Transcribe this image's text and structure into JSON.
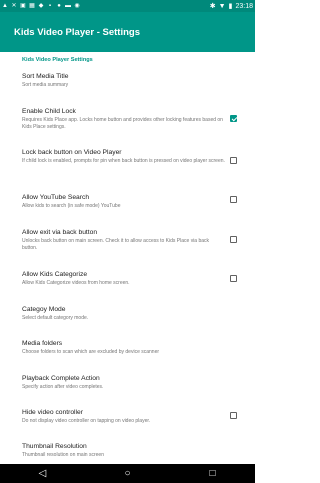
{
  "status_bar": {
    "left_icons": [
      "a-icon",
      "tools-icon",
      "photo-icon",
      "calendar-icon",
      "diamond-icon",
      "image-icon",
      "location-icon",
      "message-icon",
      "camera-icon"
    ],
    "time": "23:18"
  },
  "app_bar": {
    "title": "Kids Video Player - Settings"
  },
  "section": {
    "header": "Kids Video Player Settings"
  },
  "items": [
    {
      "title": "Sort Media Title",
      "summary": "Sort media summary",
      "has_checkbox": false
    },
    {
      "title": "Enable Child Lock",
      "summary": "Requires Kids Place app. Locks home button and provides other locking features based on Kids Place settings.",
      "has_checkbox": true,
      "checked": true
    },
    {
      "title": "Lock back button on Video Player",
      "summary": "If child lock is enabled, prompts for pin when back button is pressed on video player screen.",
      "has_checkbox": true,
      "checked": false
    },
    {
      "title": "Allow YouTube Search",
      "summary": "Allow kids to search (in safe mode) YouTube",
      "has_checkbox": true,
      "checked": false
    },
    {
      "title": "Allow exit via back button",
      "summary": "Unlocks back button on main screen. Check it to allow access to Kids Place via back button.",
      "has_checkbox": true,
      "checked": false
    },
    {
      "title": "Allow Kids Categorize",
      "summary": "Allow Kids Categorize videos from home screen.",
      "has_checkbox": true,
      "checked": false
    },
    {
      "title": "Categoy Mode",
      "summary": "Select default category mode.",
      "has_checkbox": false
    },
    {
      "title": "Media folders",
      "summary": "Choose folders to scan which are excluded by device scanner",
      "has_checkbox": false
    },
    {
      "title": "Playback Complete Action",
      "summary": "Specify action after video completes.",
      "has_checkbox": false
    },
    {
      "title": "Hide video controller",
      "summary": "Do not display video controller on tapping on video player.",
      "has_checkbox": true,
      "checked": false
    },
    {
      "title": "Thumbnail Resolution",
      "summary": "Thumbnail resolution on main screen",
      "has_checkbox": false
    }
  ],
  "nav_bar": {
    "back": "◁",
    "home": "○",
    "recents": "□"
  },
  "colors": {
    "primary": "#009688",
    "status": "#00897b"
  }
}
